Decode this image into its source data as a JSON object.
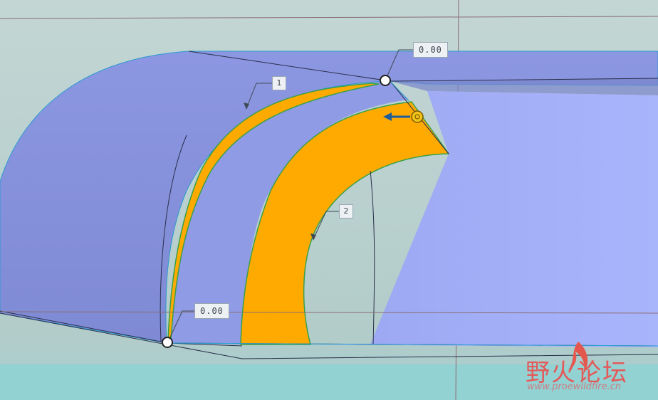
{
  "dimensions": {
    "top": "0.00",
    "bottom": "0.00"
  },
  "callouts": {
    "curve_1": "1",
    "curve_2": "2"
  },
  "watermark": {
    "title": "野火论坛",
    "url": "www.proewildfire.cn"
  },
  "colors": {
    "background": "#b9d0cf",
    "surface": "#8d99e0",
    "surface_light": "#a7b3f6",
    "highlight": "#ffaa00",
    "edge_green": "#3aa04a",
    "drag_arrow": "#1f5e9a",
    "watermark": "#e35a59"
  }
}
